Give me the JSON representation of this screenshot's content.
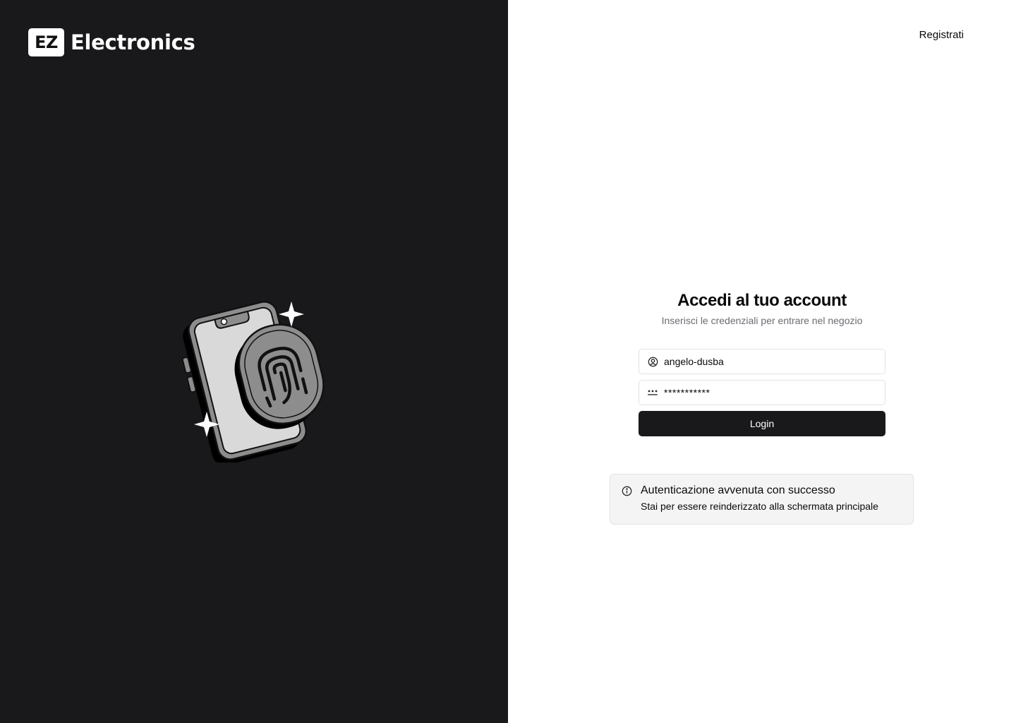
{
  "brand": {
    "mark": "EZ",
    "name": "Electronics",
    "illustration_icon": "phone-fingerprint-icon"
  },
  "header": {
    "register_label": "Registrati"
  },
  "login": {
    "title": "Accedi al tuo account",
    "subtitle": "Inserisci le credenziali per entrare nel negozio",
    "username": {
      "value": "angelo-dusba",
      "icon": "user-circle-icon"
    },
    "password": {
      "value": "***********",
      "icon": "password-dots-icon"
    },
    "submit_label": "Login"
  },
  "alert": {
    "icon": "info-icon",
    "title": "Autenticazione avvenuta con successo",
    "description": "Stai per essere reinderizzato alla schermata principale"
  },
  "colors": {
    "dark_panel": "#19191b",
    "button": "#19191b",
    "alert_background": "#f4f4f5",
    "muted_text": "#6b6b72"
  }
}
